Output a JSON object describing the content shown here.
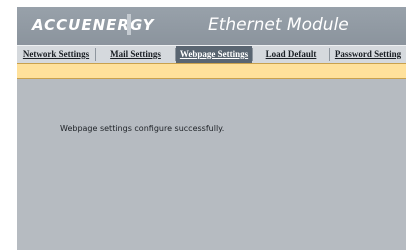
{
  "header": {
    "logo_text": "ACCUENERGY",
    "title": "Ethernet Module"
  },
  "nav": {
    "tabs": [
      {
        "label": "Network Settings",
        "active": false
      },
      {
        "label": "Mail Settings",
        "active": false
      },
      {
        "label": "Webpage Settings",
        "active": true
      },
      {
        "label": "Load Default",
        "active": false
      },
      {
        "label": "Password Setting",
        "active": false
      }
    ]
  },
  "content": {
    "message": "Webpage settings configure successfully."
  },
  "colors": {
    "header_bg": "#8b949d",
    "active_tab_bg": "#596571",
    "notice_bar_bg": "#ffe19b",
    "content_bg": "#b6bbc1"
  }
}
